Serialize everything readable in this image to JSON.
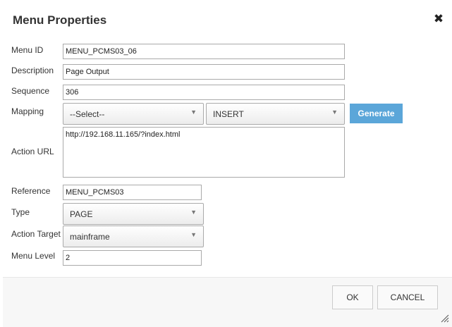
{
  "dialog": {
    "title": "Menu Properties",
    "close_glyph": "✖"
  },
  "form": {
    "menu_id": {
      "label": "Menu ID",
      "value": "MENU_PCMS03_06"
    },
    "description": {
      "label": "Description",
      "value": "Page Output"
    },
    "sequence": {
      "label": "Sequence",
      "value": "306"
    },
    "mapping": {
      "label": "Mapping",
      "select_value": "--Select--",
      "action_value": "INSERT",
      "generate_label": "Generate"
    },
    "action_url": {
      "label": "Action URL",
      "value": "http://192.168.11.165/?index.html"
    },
    "reference": {
      "label": "Reference",
      "value": "MENU_PCMS03"
    },
    "type": {
      "label": "Type",
      "value": "PAGE"
    },
    "action_target": {
      "label": "Action Target",
      "value": "mainframe"
    },
    "menu_level": {
      "label": "Menu Level",
      "value": "2"
    }
  },
  "footer": {
    "ok_label": "OK",
    "cancel_label": "CANCEL"
  },
  "icons": {
    "dropdown": "chevron-down-icon",
    "close": "close-icon",
    "resize": "resize-grip-icon"
  },
  "colors": {
    "accent": "#5ba6d9",
    "footer_bg": "#f7f7f7"
  }
}
